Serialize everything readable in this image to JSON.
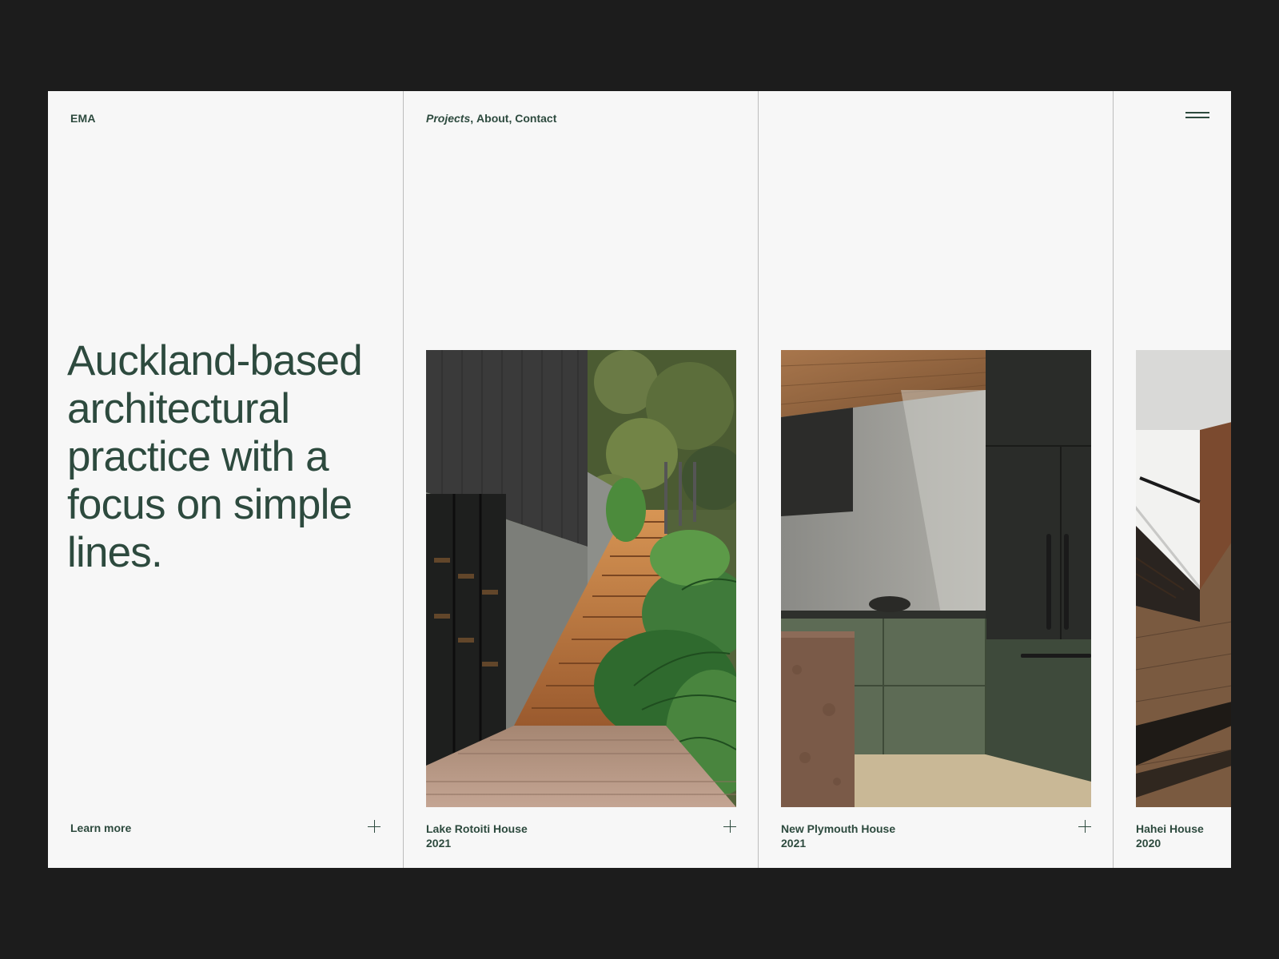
{
  "brand": {
    "logo": "EMA"
  },
  "nav": {
    "items": [
      {
        "label": "Projects",
        "active": true
      },
      {
        "label": "About",
        "active": false
      },
      {
        "label": "Contact",
        "active": false
      }
    ],
    "separator": ", "
  },
  "hero": {
    "headline": "Auckland-based architectural practice with a focus on simple lines.",
    "cta": "Learn more"
  },
  "projects": [
    {
      "title": "Lake Rotoiti House",
      "year": "2021",
      "image": "exterior-timber-stairs-with-ferns"
    },
    {
      "title": "New Plymouth House",
      "year": "2021",
      "image": "green-kitchen-with-timber-ceiling"
    },
    {
      "title": "Hahei House",
      "year": "2020",
      "image": "interior-staircase-timber-floor"
    }
  ],
  "icons": {
    "menu": "hamburger-menu-icon",
    "expand": "plus-icon"
  },
  "colors": {
    "background_outer": "#1c1c1c",
    "panel": "#f7f7f7",
    "ink": "#2d4a3e",
    "divider": "#bdbdbd"
  }
}
